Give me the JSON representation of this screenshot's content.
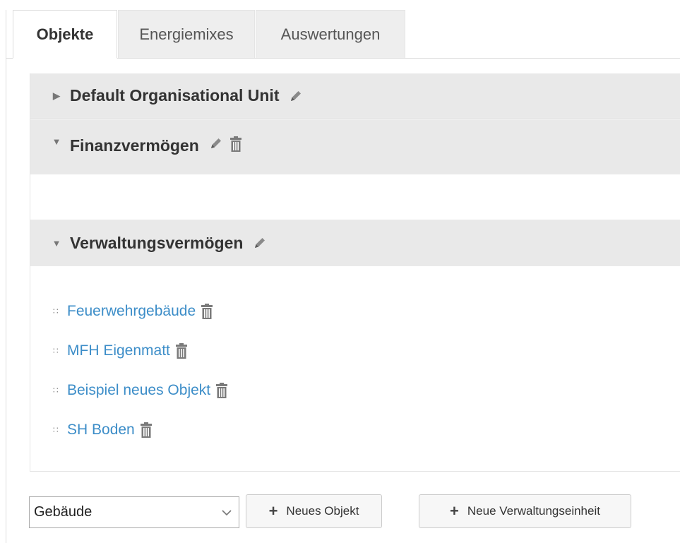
{
  "tabs": [
    {
      "label": "Objekte",
      "active": true
    },
    {
      "label": "Energiemixes",
      "active": false
    },
    {
      "label": "Auswertungen",
      "active": false
    }
  ],
  "groups": [
    {
      "label": "Default Organisational Unit",
      "expanded": false,
      "icons": [
        "pencil-icon"
      ]
    },
    {
      "label": "Finanzvermögen",
      "expanded": true,
      "icons": [
        "pencil-icon",
        "trash-icon"
      ]
    },
    {
      "label": "Verwaltungsvermögen",
      "expanded": true,
      "icons": [
        "pencil-icon"
      ]
    }
  ],
  "objects": [
    {
      "label": "Feuerwehrgebäude"
    },
    {
      "label": "MFH Eigenmatt"
    },
    {
      "label": "Beispiel neues Objekt"
    },
    {
      "label": "SH Boden"
    }
  ],
  "toolbar": {
    "type_select_value": "Gebäude",
    "new_object_label": "Neues Objekt",
    "new_unit_label": "Neue Verwaltungseinheit"
  },
  "colors": {
    "link": "#3c8dc8",
    "group_header_bg": "#e9e9e9",
    "inactive_tab_bg": "#eeeeee"
  }
}
